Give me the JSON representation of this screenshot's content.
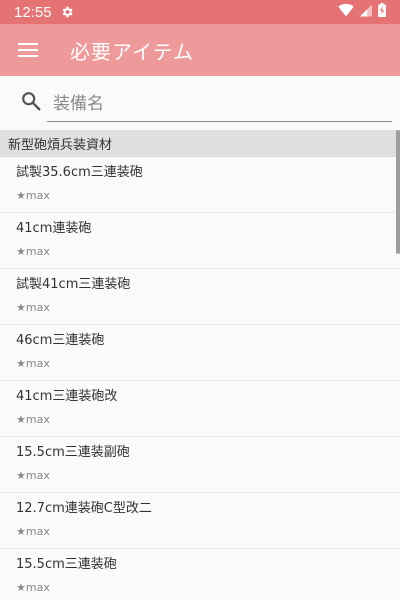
{
  "status_bar": {
    "time": "12:55"
  },
  "app_bar": {
    "title": "必要アイテム"
  },
  "search": {
    "placeholder": "装備名"
  },
  "section": {
    "title": "新型砲熕兵装資材"
  },
  "items": [
    {
      "name": "試製35.6cm三連装砲",
      "meta": "★max"
    },
    {
      "name": "41cm連装砲",
      "meta": "★max"
    },
    {
      "name": "試製41cm三連装砲",
      "meta": "★max"
    },
    {
      "name": "46cm三連装砲",
      "meta": "★max"
    },
    {
      "name": "41cm三連装砲改",
      "meta": "★max"
    },
    {
      "name": "15.5cm三連装副砲",
      "meta": "★max"
    },
    {
      "name": "12.7cm連装砲C型改二",
      "meta": "★max"
    },
    {
      "name": "15.5cm三連装砲",
      "meta": "★max"
    }
  ]
}
